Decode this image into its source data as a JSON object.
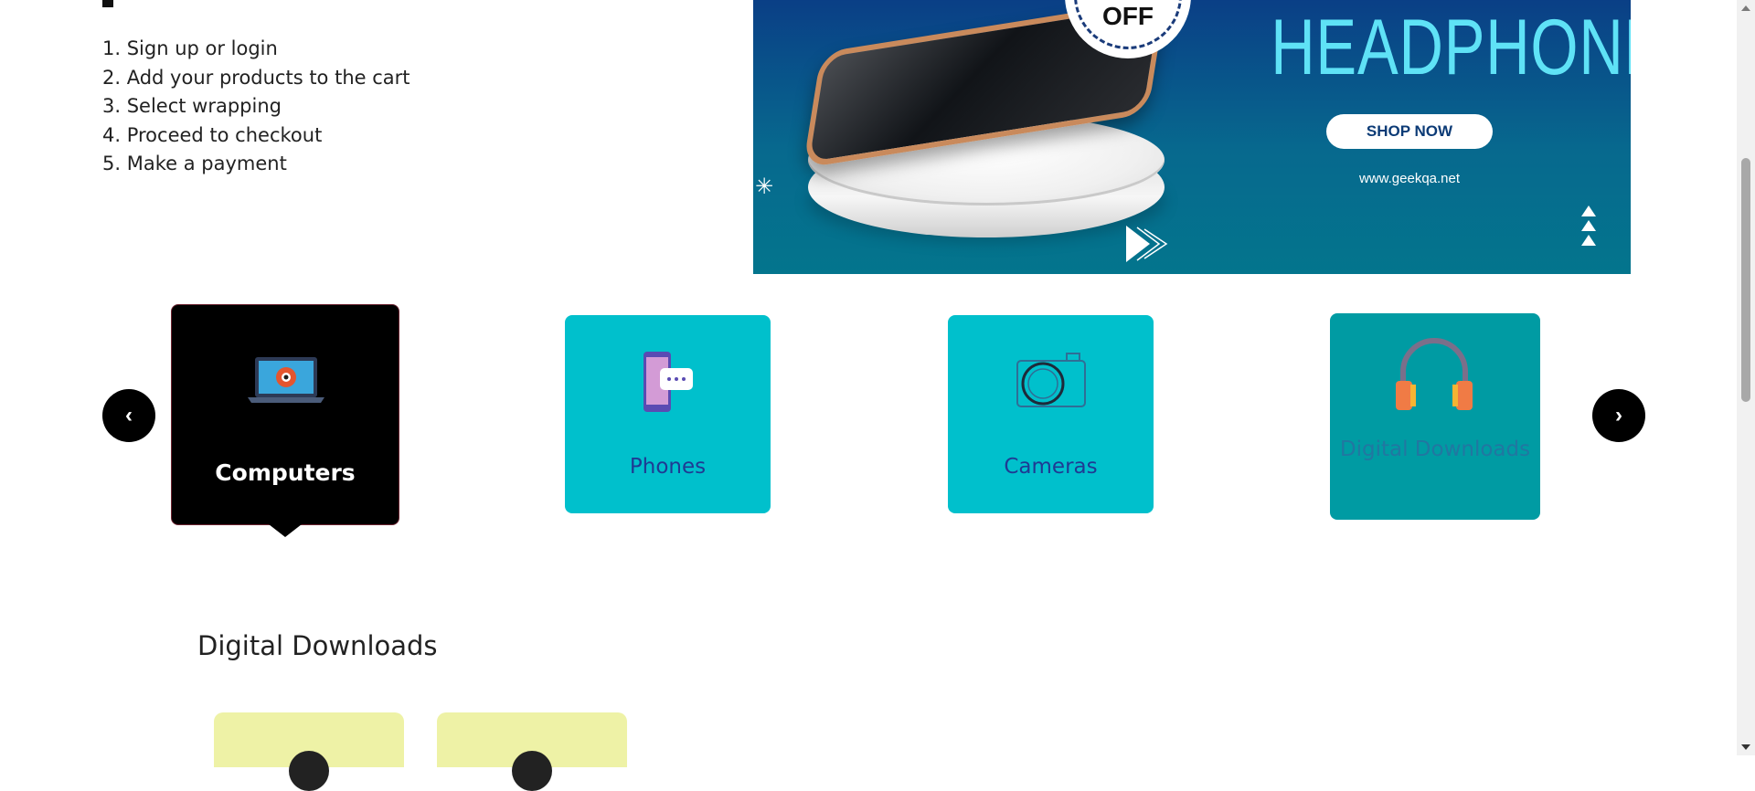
{
  "steps": [
    "1. Sign up or login",
    "2. Add your products to the cart",
    "3. Select wrapping",
    "4. Proceed to checkout",
    "5. Make a payment"
  ],
  "banner": {
    "badge_text": "OFF",
    "title": "HEADPHONE",
    "shop_button": "SHOP NOW",
    "url": "www.geekqa.net",
    "colors": {
      "top": "#0a3f86",
      "bottom": "#03758d",
      "title": "#5fe2f6"
    }
  },
  "carousel": {
    "prev_label": "‹",
    "next_label": "›",
    "categories": [
      {
        "label": "Computers",
        "icon": "laptop-gear-icon",
        "selected": true
      },
      {
        "label": "Phones",
        "icon": "smartphone-chat-icon",
        "selected": false
      },
      {
        "label": "Cameras",
        "icon": "camera-icon",
        "selected": false
      },
      {
        "label": "Digital Downloads",
        "icon": "headphones-icon",
        "selected": false
      }
    ],
    "colors": {
      "selected": "#000000",
      "card": "#00c0cc",
      "card_dim": "#009ba3",
      "label": "#1f3a93"
    }
  },
  "section": {
    "title": "Digital Downloads",
    "card_color": "#eef2a6"
  }
}
